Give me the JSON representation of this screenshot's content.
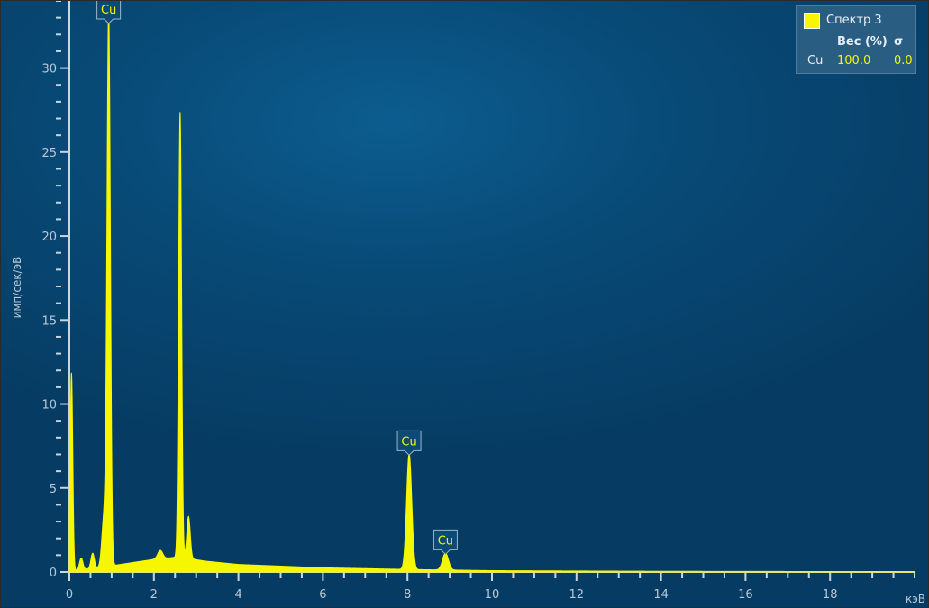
{
  "chart_data": {
    "type": "area",
    "xlabel": "кэВ",
    "ylabel": "имп/сек/эВ",
    "xlim": [
      0,
      20
    ],
    "ylim": [
      0,
      34
    ],
    "x_ticks": [
      0,
      2,
      4,
      6,
      8,
      10,
      12,
      14,
      16,
      18
    ],
    "y_ticks": [
      0,
      5,
      10,
      15,
      20,
      25,
      30
    ],
    "series": [
      {
        "name": "Спектр 3",
        "color": "#f6f600",
        "peaks": [
          {
            "x": 0.05,
            "y": 11.8,
            "width": 0.03
          },
          {
            "x": 0.28,
            "y": 0.7,
            "width": 0.04
          },
          {
            "x": 0.55,
            "y": 0.9,
            "width": 0.04
          },
          {
            "x": 0.82,
            "y": 3.0,
            "width": 0.05
          },
          {
            "x": 0.93,
            "y": 33.0,
            "width": 0.04
          },
          {
            "x": 2.15,
            "y": 0.5,
            "width": 0.06
          },
          {
            "x": 2.62,
            "y": 26.5,
            "width": 0.035
          },
          {
            "x": 2.82,
            "y": 2.5,
            "width": 0.04
          },
          {
            "x": 8.04,
            "y": 6.9,
            "width": 0.06
          },
          {
            "x": 8.9,
            "y": 1.0,
            "width": 0.07
          }
        ],
        "background": [
          [
            0,
            0.05
          ],
          [
            0.5,
            0.2
          ],
          [
            1.2,
            0.45
          ],
          [
            2.0,
            0.75
          ],
          [
            2.6,
            0.9
          ],
          [
            3.2,
            0.65
          ],
          [
            4.0,
            0.45
          ],
          [
            6.0,
            0.25
          ],
          [
            8.0,
            0.15
          ],
          [
            10.0,
            0.08
          ],
          [
            14.0,
            0.04
          ],
          [
            20.0,
            0.02
          ]
        ]
      }
    ],
    "peak_labels": [
      {
        "text": "Cu",
        "x": 0.93,
        "y": 33.0
      },
      {
        "text": "Cu",
        "x": 8.04,
        "y": 6.9
      },
      {
        "text": "Cu",
        "x": 8.9,
        "y": 1.0
      }
    ]
  },
  "legend": {
    "series_name": "Спектр 3",
    "col_weight": "Вес (%)",
    "col_sigma": "σ",
    "rows": [
      {
        "element": "Cu",
        "weight": "100.0",
        "sigma": "0.0"
      }
    ]
  }
}
